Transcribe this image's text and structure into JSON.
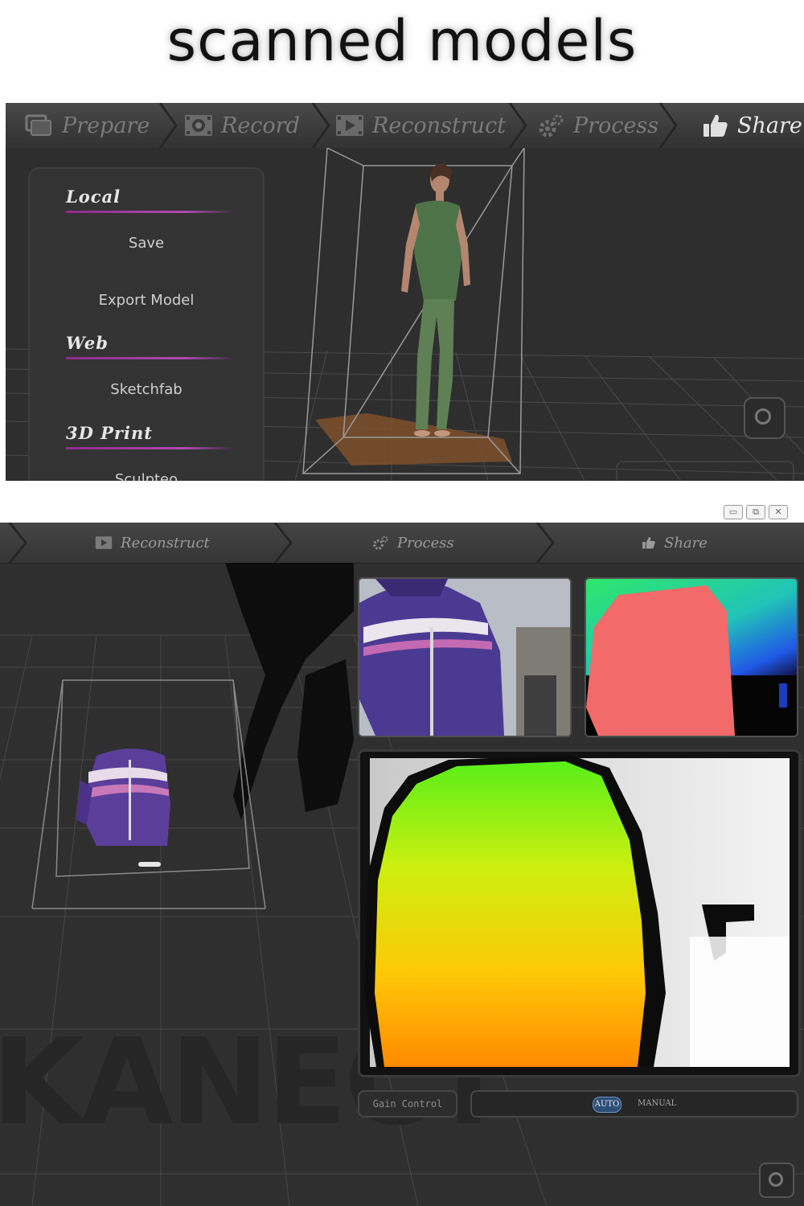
{
  "caption": "scanned models",
  "top_window": {
    "tabs": [
      {
        "label": "Prepare",
        "icon": "prepare-icon",
        "active": false
      },
      {
        "label": "Record",
        "icon": "record-icon",
        "active": false
      },
      {
        "label": "Reconstruct",
        "icon": "reconstruct-icon",
        "active": false
      },
      {
        "label": "Process",
        "icon": "gear-icon",
        "active": false
      },
      {
        "label": "Share",
        "icon": "thumbs-up-icon",
        "active": true
      }
    ],
    "share_panel": {
      "local_heading": "Local",
      "save_label": "Save",
      "export_label": "Export Model",
      "web_heading": "Web",
      "sketchfab_label": "Sketchfab",
      "print_heading": "3D Print",
      "sculpteo_label": "Sculpteo"
    },
    "accent_color": "#a03aa0"
  },
  "bottom_window": {
    "window_controls": [
      "▭",
      "⧉",
      "✕"
    ],
    "tabs": [
      {
        "label": "Reconstruct",
        "icon": "reconstruct-icon"
      },
      {
        "label": "Process",
        "icon": "gear-icon"
      },
      {
        "label": "Share",
        "icon": "thumbs-up-icon"
      }
    ],
    "gain_control_label": "Gain Control",
    "gain_auto_label": "AUTO",
    "gain_manual_label": "MANUAL",
    "watermark_text": "KANECT"
  }
}
